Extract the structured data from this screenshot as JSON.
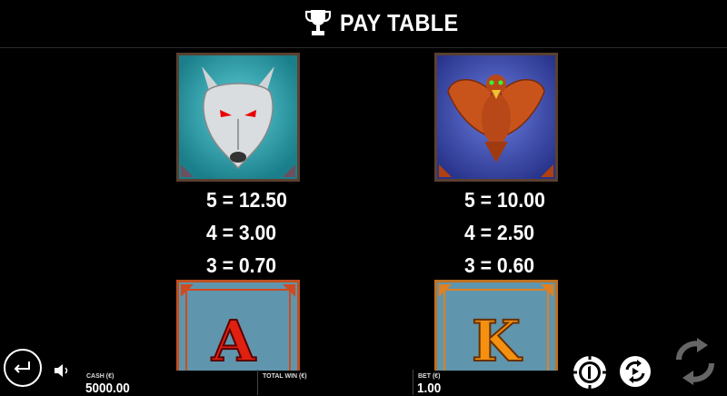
{
  "header": {
    "title": "PAY TABLE",
    "icon": "trophy-icon"
  },
  "symbols": [
    {
      "name": "wolf",
      "payouts": [
        "5 = 12.50",
        "4 = 3.00",
        "3 = 0.70"
      ],
      "bg": "#2fa6b0"
    },
    {
      "name": "eagle",
      "payouts": [
        "5 = 10.00",
        "4 = 2.50",
        "3 = 0.60"
      ],
      "bg": "#3d4fb0"
    },
    {
      "name": "letter-a",
      "glyph": "A",
      "bg": "#5a8fa8"
    },
    {
      "name": "letter-k",
      "glyph": "K",
      "bg": "#5a8fa8"
    }
  ],
  "footer": {
    "cash_label": "CASH (€)",
    "cash_value": "5000.00",
    "total_win_label": "TOTAL WIN (€)",
    "bet_label": "BET (€)",
    "bet_value": "1.00"
  }
}
